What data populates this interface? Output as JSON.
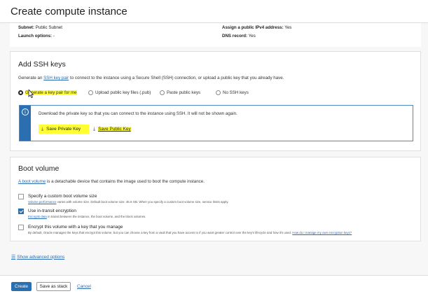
{
  "header": {
    "title": "Create compute instance"
  },
  "subnet_summary": {
    "subnet_label": "Subnet:",
    "subnet_value": "Public Subnet",
    "launch_label": "Launch options:",
    "launch_value": "-",
    "ipv4_label": "Assign a public IPv4 address:",
    "ipv4_value": "Yes",
    "dns_label": "DNS record:",
    "dns_value": "Yes"
  },
  "ssh": {
    "title": "Add SSH keys",
    "desc_prefix": "Generate an",
    "desc_link": "SSH key pair",
    "desc_suffix": "to connect to the instance using a Secure Shell (SSH) connection, or upload a public key that you already have.",
    "options": [
      "Generate a key pair for me",
      "Upload public key files (.pub)",
      "Paste public keys",
      "No SSH keys"
    ],
    "selected_option": "Generate a key pair for me",
    "info_text": "Download the private key so that you can connect to the instance using SSH. It will not be shown again.",
    "save_private": "Save Private Key",
    "save_public": "Save Public Key"
  },
  "boot": {
    "title": "Boot volume",
    "desc_link": "A boot volume",
    "desc_suffix": "is a detachable device that contains the image used to boot the compute instance.",
    "custom_size_label": "Specify a custom boot volume size",
    "custom_size_hint_link": "Volume performance",
    "custom_size_hint": "varies with volume size. Default boot volume size: 46.6 GB. When you specify a custom boot volume size, service limits apply.",
    "transit_label": "Use in-transit encryption",
    "transit_hint_link": "Encrypts data",
    "transit_hint": "in transit between the instance, the boot volume, and the block volumes.",
    "encrypt_label": "Encrypt this volume with a key that you manage",
    "encrypt_hint": "By default, Oracle manages the keys that encrypt this volume, but you can choose a key from a vault that you have access to if you want greater control over the key's lifecycle and how it's used.",
    "encrypt_hint_link": "How do I manage my own encryption keys?"
  },
  "advanced": {
    "label": "Show advanced options"
  },
  "footer": {
    "create": "Create",
    "save_stack": "Save as stack",
    "cancel": "Cancel"
  },
  "colors": {
    "primary": "#2c6fb0",
    "link": "#2b6bb5",
    "highlight": "#ffff33"
  }
}
